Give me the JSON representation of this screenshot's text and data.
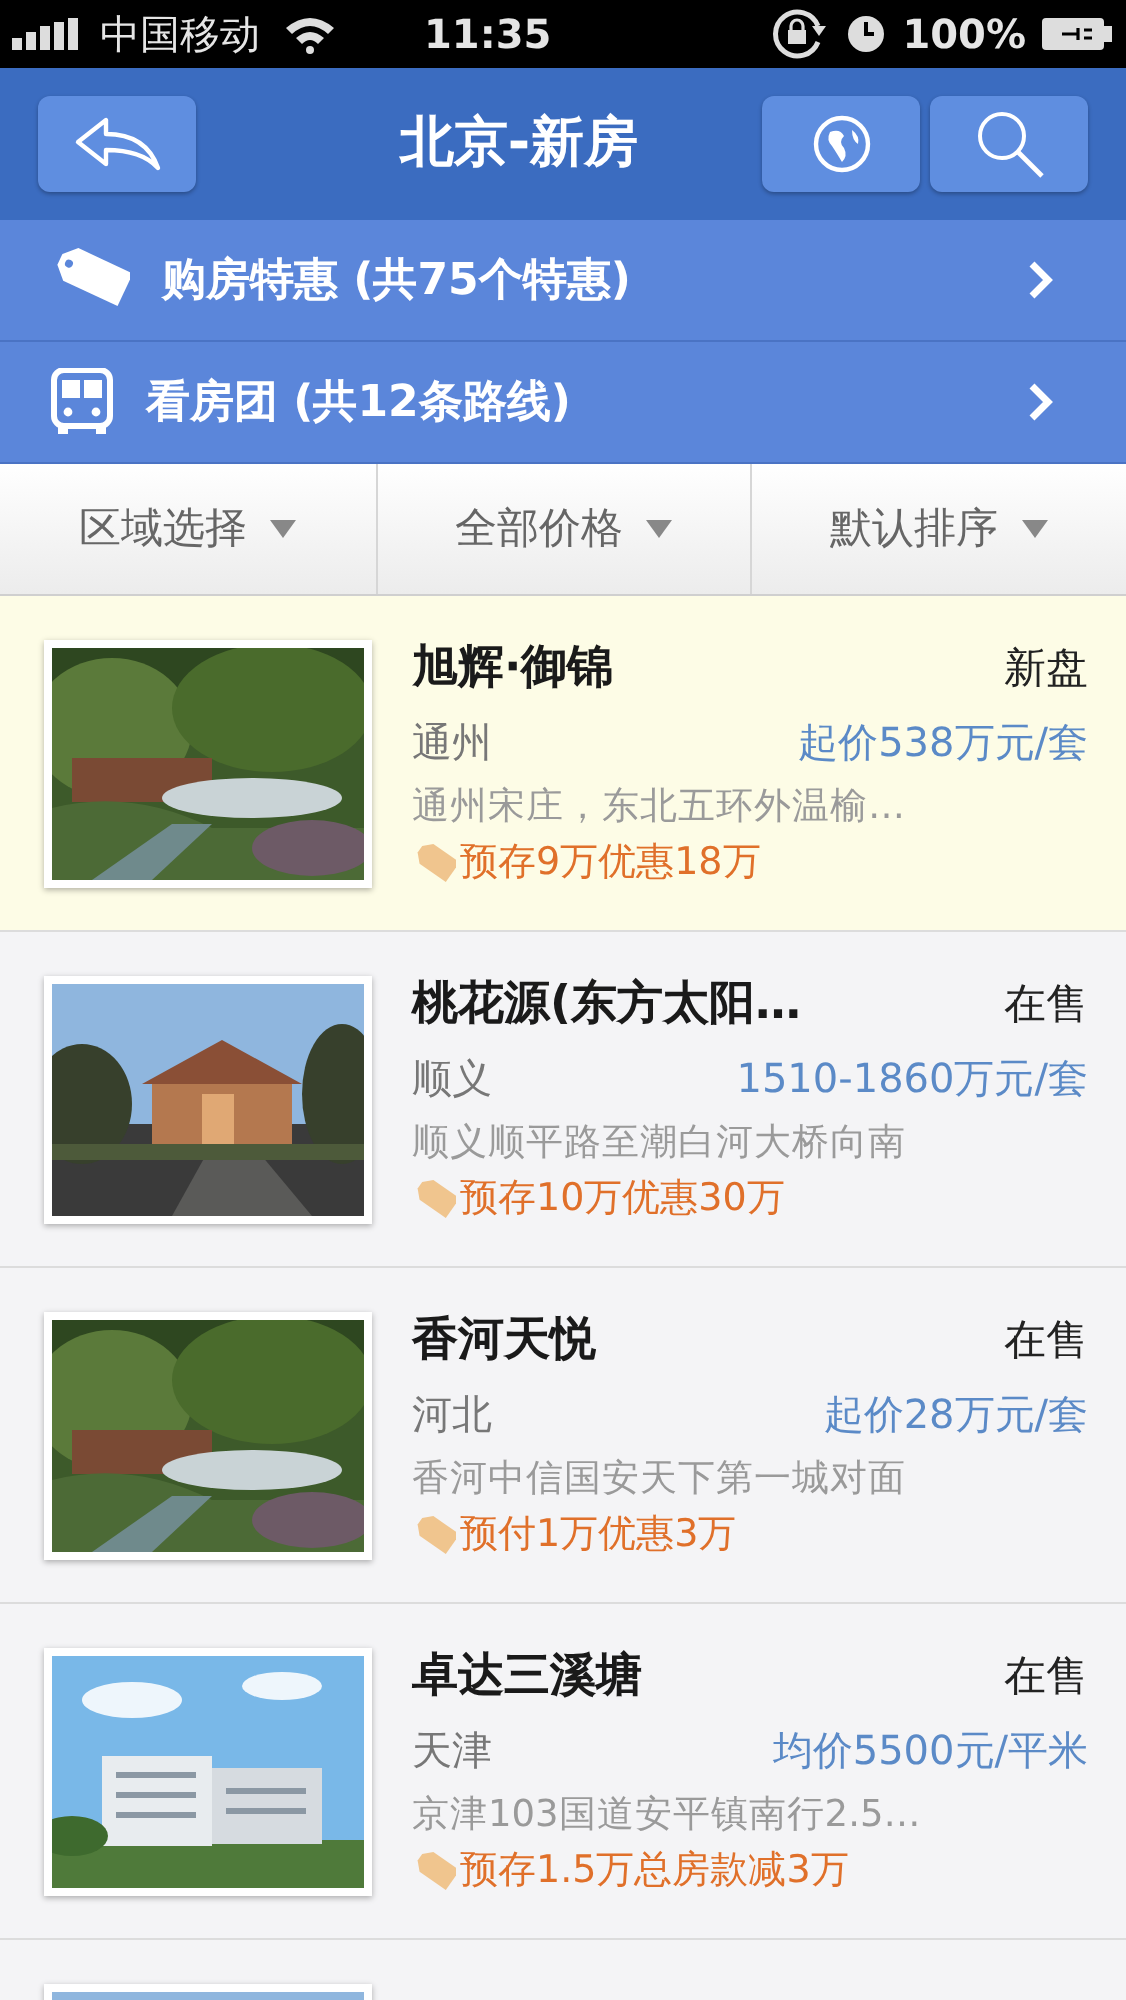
{
  "status_bar": {
    "carrier": "中国移动",
    "time": "11:35",
    "battery": "100%"
  },
  "nav": {
    "title": "北京-新房"
  },
  "promos": [
    {
      "kind": "sale",
      "text": "购房特惠 (共75个特惠)"
    },
    {
      "kind": "bus",
      "text": "看房团 (共12条路线)"
    }
  ],
  "filters": [
    "区域选择",
    "全部价格",
    "默认排序"
  ],
  "listings": [
    {
      "highlighted": true,
      "name": "旭辉·御锦",
      "status": "新盘",
      "district": "通州",
      "price": "起价538万元/套",
      "address": "通州宋庄，东北五环外温榆…",
      "offer": "预存9万优惠18万"
    },
    {
      "highlighted": false,
      "name": "桃花源(东方太阳…",
      "status": "在售",
      "district": "顺义",
      "price": "1510-1860万元/套",
      "address": "顺义顺平路至潮白河大桥向南",
      "offer": "预存10万优惠30万"
    },
    {
      "highlighted": false,
      "name": "香河天悦",
      "status": "在售",
      "district": "河北",
      "price": "起价28万元/套",
      "address": "香河中信国安天下第一城对面",
      "offer": "预付1万优惠3万"
    },
    {
      "highlighted": false,
      "name": "卓达三溪塘",
      "status": "在售",
      "district": "天津",
      "price": "均价5500元/平米",
      "address": "京津103国道安平镇南行2.5…",
      "offer": "预存1.5万总房款减3万"
    },
    {
      "highlighted": false
    }
  ]
}
